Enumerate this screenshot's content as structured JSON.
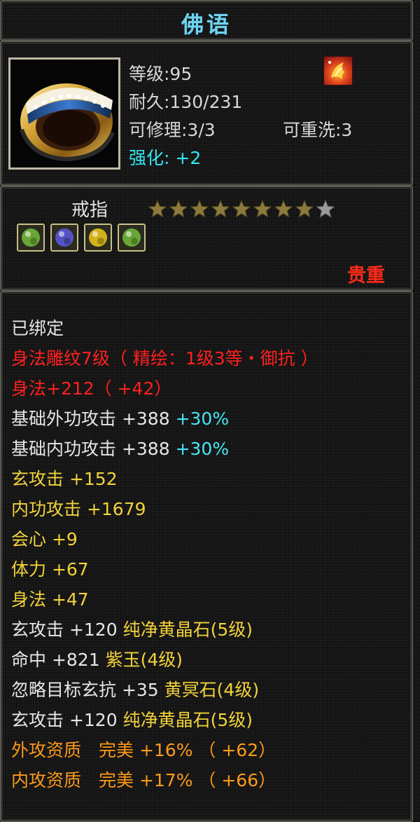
{
  "title": "佛语",
  "info": {
    "level": "等级:95",
    "durability": "耐久:130/231",
    "repair": "可修理:3/3",
    "rewash": "可重洗:3",
    "strength": "强化: +2"
  },
  "item": {
    "name": "戒指",
    "stars_filled": 8,
    "stars_total": 9,
    "quality": "贵重",
    "gems": [
      {
        "icon": "green-gem-icon",
        "color": "#6fb53a"
      },
      {
        "icon": "purple-gem-icon",
        "color": "#5a58d6"
      },
      {
        "icon": "yellow-gem-icon",
        "color": "#e6c21c"
      },
      {
        "icon": "green-gem-icon",
        "color": "#6fb53a"
      }
    ]
  },
  "stats": {
    "bound": "已绑定",
    "engraving": "身法雕纹7级（ 精绘：1级3等・御抗 ）",
    "agility_total": "身法+212（ +42）",
    "ext_attack": "基础外功攻击 +388",
    "ext_attack_pct": "+30%",
    "int_attack": "基础内功攻击 +388",
    "int_attack_pct": "+30%",
    "xuan_attack": "玄攻击 +152",
    "int_gong_attack": "内功攻击 +1679",
    "crit": "会心 +9",
    "stamina": "体力 +67",
    "agility": "身法 +47",
    "gem1_stat": "玄攻击 +120",
    "gem1_name": "纯净黄晶石(5级)",
    "gem2_stat": "命中 +821",
    "gem2_name": "紫玉(4级)",
    "gem3_stat": "忽略目标玄抗 +35",
    "gem3_name": "黄冥石(4级)",
    "gem4_stat": "玄攻击 +120",
    "gem4_name": "纯净黄晶石(5级)",
    "ext_quality": "外攻资质　完美 +16% （ +62）",
    "int_quality": "内攻资质　完美 +17% （ +66）"
  },
  "colors": {
    "title": "#6fd3ee",
    "quality": "#ff2a1a",
    "engraving": "#ff2020",
    "yellow": "#f2d23a",
    "orange": "#ff9a1a",
    "cyan": "#45e6f5"
  }
}
